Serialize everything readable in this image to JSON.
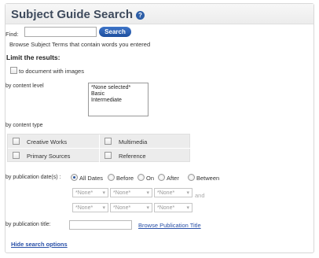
{
  "header": {
    "title": "Subject Guide Search"
  },
  "find": {
    "label": "Find:",
    "value": "",
    "button": "Search",
    "hint": "Browse Subject Terms that contain words you entered"
  },
  "limit": {
    "heading": "Limit the results:",
    "images_label": "to document with images",
    "content_level_label": "by content level",
    "content_levels": [
      "*None selected*",
      "Basic",
      "Intermediate"
    ],
    "content_type_label": "by content type",
    "content_types": [
      "Creative Works",
      "Multimedia",
      "Primary Sources",
      "Reference"
    ]
  },
  "pubdate": {
    "label": "by publication date(s) :",
    "options": [
      "All Dates",
      "Before",
      "On",
      "After",
      "Between"
    ],
    "selected": "All Dates",
    "row1": [
      "*None*",
      "*None*",
      "*None*"
    ],
    "row2": [
      "*None*",
      "*None*",
      "*None*"
    ],
    "and_label": "and"
  },
  "pubtitle": {
    "label": "by publication title:",
    "value": "",
    "browse_link": "Browse Publication Title"
  },
  "footer": {
    "hide_link": "Hide search options"
  },
  "icons": {
    "help": "help-icon",
    "dropdown": "chevron-down-icon"
  },
  "colors": {
    "accent": "#2d5ea7",
    "title": "#3e4a5c",
    "link": "#2950a8"
  }
}
